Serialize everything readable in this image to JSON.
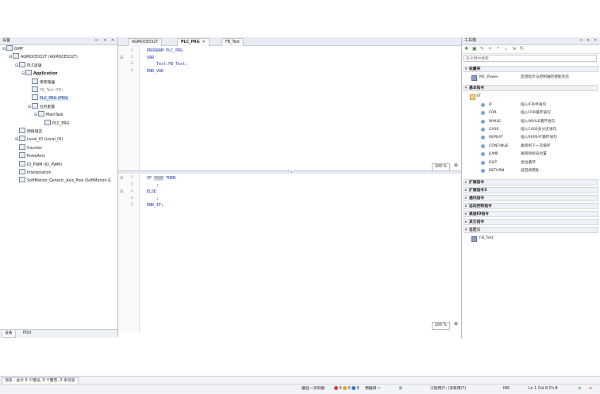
{
  "left_panel": {
    "title": "设备",
    "tree": [
      {
        "label": "GMP",
        "level": 0,
        "expander": "⊟"
      },
      {
        "label": "AGMOCE032T (AGMOCE032T)",
        "level": 1,
        "expander": "⊟"
      },
      {
        "label": "PLC逻辑",
        "level": 2,
        "expander": "⊟"
      },
      {
        "label": "Application",
        "level": 3,
        "expander": "⊟",
        "bold": true
      },
      {
        "label": "库管理器",
        "level": 4,
        "expander": ""
      },
      {
        "label": "FB_Test (FB)",
        "level": 4,
        "expander": "",
        "dim": true
      },
      {
        "label": "PLC_PRG (PRG)",
        "level": 4,
        "expander": "",
        "selected": true
      },
      {
        "label": "任务配置",
        "level": 4,
        "expander": "⊟"
      },
      {
        "label": "MainTask",
        "level": 5,
        "expander": "⊟"
      },
      {
        "label": "PLC_PRG",
        "level": 6,
        "expander": ""
      },
      {
        "label": "网络组态",
        "level": 2,
        "expander": ""
      },
      {
        "label": "Local_IO (Local_IO)",
        "level": 2,
        "expander": "⊞"
      },
      {
        "label": "Counter",
        "level": 2,
        "expander": ""
      },
      {
        "label": "PulseAxis",
        "level": 2,
        "expander": ""
      },
      {
        "label": "IO_PWM (IO_PWM)",
        "level": 2,
        "expander": ""
      },
      {
        "label": "Interpolation",
        "level": 2,
        "expander": ""
      },
      {
        "label": "SoftMotion_Generic_Axis_Pool (SoftMotion G",
        "level": 2,
        "expander": ""
      }
    ],
    "tabs": [
      "设备",
      "POU"
    ]
  },
  "editor": {
    "tabs": [
      {
        "label": "AGMOCE032T",
        "active": false
      },
      {
        "label": "PLC_PRG",
        "active": true
      },
      {
        "label": "FB_Test",
        "active": false
      }
    ],
    "top_lines": [
      {
        "n": "1",
        "text": "PROGRAM PLC_PRG",
        "fold": ""
      },
      {
        "n": "2",
        "text": "VAR",
        "fold": "⊟"
      },
      {
        "n": "3",
        "text": "    Test:FB_Test;",
        "fold": ""
      },
      {
        "n": "4",
        "text": "END_VAR",
        "fold": ""
      }
    ],
    "bottom_lines": [
      {
        "n": "1",
        "kw1": "IF ",
        "hl": "TRUE",
        "kw2": " THEN",
        "fold": "⊟"
      },
      {
        "n": "2",
        "text": "    ;",
        "fold": ""
      },
      {
        "n": "3",
        "text": "ELSE",
        "fold": "⊟"
      },
      {
        "n": "4",
        "text": "    ;",
        "fold": ""
      },
      {
        "n": "5",
        "text": "END_IF;",
        "fold": ""
      }
    ],
    "zoom_top": "100 %",
    "zoom_bottom": "100 %"
  },
  "toolbox": {
    "title": "工具箱",
    "search_placeholder": "在文档中搜索",
    "sections": [
      {
        "label": "收藏夹",
        "items": [
          {
            "name": "MC_Power",
            "desc": "反馈指示与控制轴的使能状态"
          }
        ]
      },
      {
        "label": "基本指令",
        "items": [
          {
            "name": "ST",
            "desc": ""
          },
          {
            "name": "IF",
            "desc": "插入IF条件语句"
          },
          {
            "name": "FOR",
            "desc": "插入FOR循环语句"
          },
          {
            "name": "WHILE",
            "desc": "插入WHILE循环语句"
          },
          {
            "name": "CASE",
            "desc": "插入CASE多分支语句"
          },
          {
            "name": "REPEAT",
            "desc": "插入REPEAT循环语句"
          },
          {
            "name": "CONTINUE",
            "desc": "跳转到下一次循环"
          },
          {
            "name": "JUMP",
            "desc": "跳转到标号位置"
          },
          {
            "name": "EXIT",
            "desc": "退出循环"
          },
          {
            "name": "RETURN",
            "desc": "返回调用处"
          }
        ]
      },
      {
        "label": "扩展指令",
        "items": []
      },
      {
        "label": "扩展指令2",
        "items": []
      },
      {
        "label": "通讯指令",
        "items": []
      },
      {
        "label": "运动控制指令",
        "items": []
      },
      {
        "label": "高速IO指令",
        "items": []
      },
      {
        "label": "其它指令",
        "items": []
      },
      {
        "label": "自定义",
        "items": [
          {
            "name": "FB_Test",
            "desc": ""
          }
        ]
      }
    ]
  },
  "status": {
    "message": "消息 - 总计 0 个错误, 0 个警告, 0 条消息",
    "last_build_label": "最后一次构建:",
    "errors": "0",
    "warnings": "0",
    "infos": "0",
    "precompile": "预编译",
    "project_user": "工程用户: (没有用户)",
    "ins": "INS",
    "position": "Ln 1  Col 8  Ch 8"
  }
}
